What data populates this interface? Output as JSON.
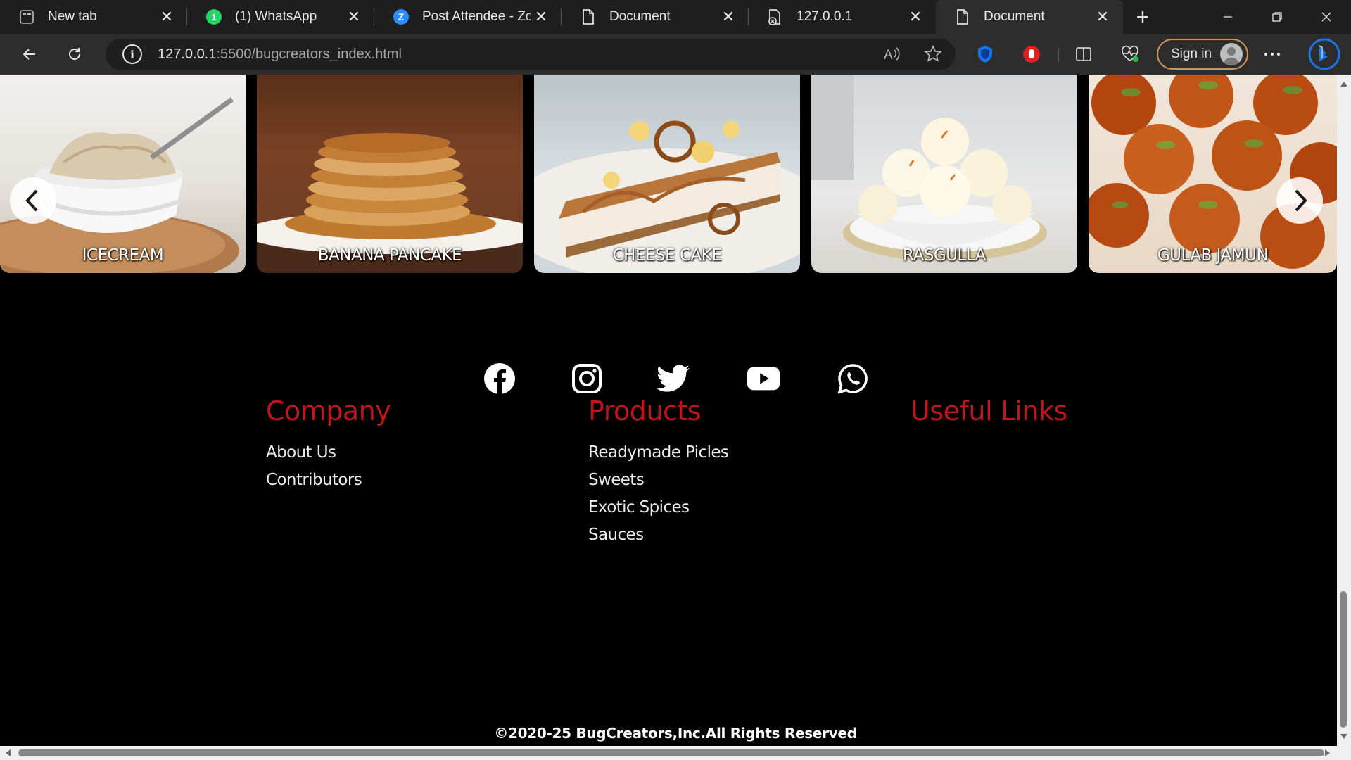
{
  "browser": {
    "tabs": [
      {
        "label": "New tab",
        "icon": "newtab-icon"
      },
      {
        "label": "(1) WhatsApp",
        "icon": "whatsapp-icon"
      },
      {
        "label": "Post Attendee - Zoom",
        "icon": "zoom-icon"
      },
      {
        "label": "Document",
        "icon": "document-icon"
      },
      {
        "label": "127.0.0.1",
        "icon": "document-icon"
      },
      {
        "label": "Document",
        "icon": "document-icon"
      }
    ],
    "url_host": "127.0.0.1",
    "url_rest": ":5500/bugcreators_index.html",
    "signin_label": "Sign in"
  },
  "carousel": {
    "items": [
      {
        "label": "ICECREAM"
      },
      {
        "label": "BANANA PANCAKE"
      },
      {
        "label": "CHEESE CAKE"
      },
      {
        "label": "RASGULLA"
      },
      {
        "label": "GULAB JAMUN"
      }
    ]
  },
  "social": [
    "facebook-icon",
    "instagram-icon",
    "twitter-icon",
    "youtube-icon",
    "whatsapp-icon"
  ],
  "footer": {
    "company": {
      "title": "Company",
      "links": [
        "About Us",
        "Contributors"
      ]
    },
    "products": {
      "title": "Products",
      "links": [
        "Readymade Picles",
        "Sweets",
        "Exotic Spices",
        "Sauces"
      ]
    },
    "useful": {
      "title": "Useful Links",
      "links": []
    },
    "copyright": "©2020-25 BugCreators,Inc.All Rights Reserved"
  },
  "colors": {
    "accent": "#c4141b",
    "chrome_dark": "#1f1f1f",
    "chrome_mid": "#2d2d2d",
    "signin_border": "#d79355"
  }
}
